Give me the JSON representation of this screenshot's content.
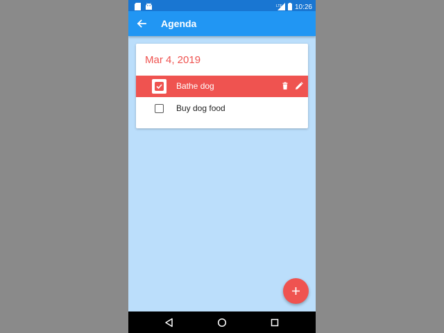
{
  "status_bar": {
    "time": "10:26",
    "network_label": "LTE"
  },
  "app_bar": {
    "title": "Agenda"
  },
  "agenda": {
    "date": "Mar 4, 2019",
    "tasks": [
      {
        "label": "Bathe dog",
        "checked": true,
        "selected": true
      },
      {
        "label": "Buy dog food",
        "checked": false,
        "selected": false
      }
    ]
  },
  "colors": {
    "primary": "#2196f3",
    "status_bar": "#1976d2",
    "accent": "#ef5350",
    "background": "#bbdefb"
  },
  "icons": {
    "back": "arrow-left-icon",
    "delete": "trash-icon",
    "edit": "pencil-icon",
    "add": "plus-icon"
  }
}
